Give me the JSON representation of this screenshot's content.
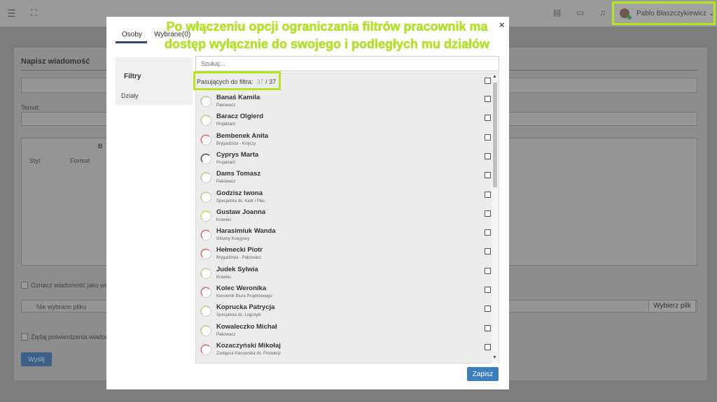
{
  "topbar": {
    "menu_icon": "hamburger-icon",
    "fullscreen_icon": "expand-icon",
    "user_name": "Pablo Błaszczykiewicz",
    "user_chevron": "⌄"
  },
  "background": {
    "title": "Napisz wiadomość",
    "subject_label": "Temat:",
    "style_select": "Styl",
    "format_select": "Format",
    "bold_btn": "B",
    "mark_label": "Oznacz wiadomość jako waż",
    "file_placeholder": "Nie wybrano pliku",
    "choose_files_btn": "Wybierz plik",
    "confirm_label": "Żądaj potwierdzenia wiadom",
    "send_btn": "Wyślij"
  },
  "annotation": {
    "line1": "Po włączeniu opcji ograniczania filtrów pracownik ma",
    "line2": "dostęp wyłącznie do swojego i podległych mu działów"
  },
  "modal": {
    "close": "×",
    "tabs": {
      "osoby": "Osoby",
      "wybrane": "Wybrane(0)"
    },
    "filters_title": "Filtry",
    "filters_item": "Działy",
    "search_placeholder": "Szukaj...",
    "count_label": "Pasujących do filtra:",
    "count_matched": "37",
    "count_total": "/ 37",
    "save": "Zapisz",
    "people": [
      {
        "name": "Banaś Kamila",
        "position": "Pakowacz",
        "ring": "#b5d96b"
      },
      {
        "name": "Baracz Olgierd",
        "position": "Projektant",
        "ring": "#b5d96b"
      },
      {
        "name": "Bembenek Anita",
        "position": "Brygadzista - Krojczy",
        "ring": "#d94a4a"
      },
      {
        "name": "Cyprys Marta",
        "position": "Projektant",
        "ring": "#222222"
      },
      {
        "name": "Dams Tomasz",
        "position": "Pakowacz",
        "ring": "#b5d96b"
      },
      {
        "name": "Godzisz Iwona",
        "position": "Specjalista ds. Kadr i Płac",
        "ring": "#b5d96b"
      },
      {
        "name": "Gustaw Joanna",
        "position": "Krawiec",
        "ring": "#e6e61d"
      },
      {
        "name": "Harasimiuk Wanda",
        "position": "Główny Księgowy",
        "ring": "#d94a4a"
      },
      {
        "name": "Hełmecki Piotr",
        "position": "Brygadzista - Pakowacz",
        "ring": "#d94a4a"
      },
      {
        "name": "Judek Sylwia",
        "position": "Krawiec",
        "ring": "#b5d96b"
      },
      {
        "name": "Kolec Weronika",
        "position": "Kierownik Biura Projektowego",
        "ring": "#d94a4a"
      },
      {
        "name": "Koprucka Patrycja",
        "position": "Specjalista ds. Logistyki",
        "ring": "#b5d96b"
      },
      {
        "name": "Kowaleczko Michał",
        "position": "Pakowacz",
        "ring": "#b5d96b"
      },
      {
        "name": "Kozaczyński Mikołaj",
        "position": "Zastępca Kierownika ds. Produkcji",
        "ring": "#d94a4a"
      }
    ]
  }
}
